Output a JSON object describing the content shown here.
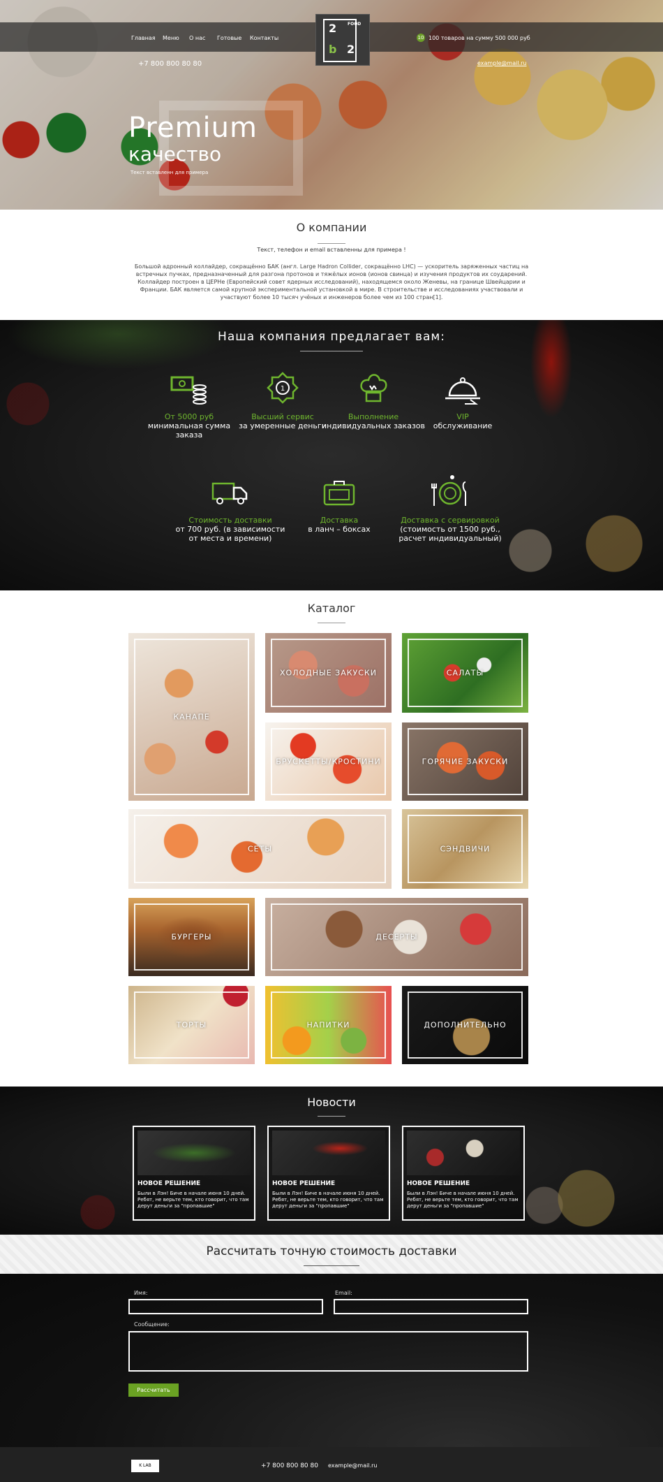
{
  "nav": {
    "items": [
      "Главная",
      "Меню",
      "О нас",
      "Готовые",
      "Контакты"
    ]
  },
  "logo": {
    "tl": "2",
    "tr": "FOOD",
    "br": "2",
    "bl": "b"
  },
  "header": {
    "cart_count": "10",
    "cart_text": "100 товаров на сумму 500 000 руб",
    "phone": "+7 800 800 80 80",
    "email": "example@mail.ru"
  },
  "hero": {
    "title": "Premium",
    "subtitle": "качество",
    "caption": "Текст вставленн для примера"
  },
  "about": {
    "title": "О компании",
    "sub": "Текст, телефон и email вставленны для примера !",
    "body": "Большой адронный коллайдер, сокращённо БАК (англ. Large Hadron Collider, сокращённо LHC) — ускоритель заряженных частиц на встречных пучках, предназначенный для разгона протонов и тяжёлых ионов (ионов свинца) и изучения продуктов их соударений. Коллайдер построен в ЦЕРНе (Европейский совет ядерных исследований), находящемся около Женевы, на границе Швейцарии и Франции. БАК является самой крупной экспериментальной установкой в мире. В строительстве и исследованиях участвовали и участвуют более 10 тысяч учёных и инженеров более чем из 100 стран[1]."
  },
  "offer": {
    "title": "Наша компания предлагает вам:",
    "items": [
      {
        "icon": "money-icon",
        "green": "От 5000 руб",
        "white": "минимальная сумма заказа"
      },
      {
        "icon": "award-medal-icon",
        "green": "Высший сервис",
        "white": "за умеренные деньги"
      },
      {
        "icon": "chef-hat-icon",
        "green": "Выполнение",
        "white": "индивидуальных заказов"
      },
      {
        "icon": "cloche-icon",
        "green": "VIP",
        "white": "обслуживание"
      },
      {
        "icon": "delivery-truck-icon",
        "green": "Стоимость доставки",
        "white": "от 700 руб. (в зависимости от места и времени)"
      },
      {
        "icon": "lunchbox-icon",
        "green": "Доставка",
        "white": "в ланч – боксах"
      },
      {
        "icon": "plate-cutlery-icon",
        "green": "Доставка с сервировкой",
        "white": "(стоимость от 1500 руб., расчет индивидуальный)"
      }
    ]
  },
  "catalog": {
    "title": "Каталог",
    "items": [
      "КАНАПЕ",
      "ХОЛОДНЫЕ ЗАКУСКИ",
      "САЛАТЫ",
      "БРУСКЕТТЫ/КРОСТИНИ",
      "ГОРЯЧИЕ ЗАКУСКИ",
      "СЕТЫ",
      "СЭНДВИЧИ",
      "БУРГЕРЫ",
      "ДЕСЕРТЫ",
      "ТОРТЫ",
      "НАПИТКИ",
      "ДОПОЛНИТЕЛЬНО"
    ]
  },
  "news": {
    "title": "Новости",
    "items": [
      {
        "title": "НОВОЕ РЕШЕНИЕ",
        "text": "Были в Лэн! Биче в начале июня 10 дней. Ребят, не верьте тем, кто говорит, что там дерут деньги за \"пропавшие\""
      },
      {
        "title": "НОВОЕ РЕШЕНИЕ",
        "text": "Были в Лэн! Биче в начале июня 10 дней. Ребят, не верьте тем, кто говорит, что там дерут деньги за \"пропавшие\""
      },
      {
        "title": "НОВОЕ РЕШЕНИЕ",
        "text": "Были в Лэн! Биче в начале июня 10 дней. Ребят, не верьте тем, кто говорит, что там дерут деньги за \"пропавшие\""
      }
    ]
  },
  "calc": {
    "title": "Рассчитать точную стоимость доставки",
    "name_label": "Имя:",
    "email_label": "Email:",
    "message_label": "Сообщение:",
    "button": "Рассчитать"
  },
  "footer": {
    "badge": "K LAB",
    "phone": "+7 800 800 80 80",
    "email": "example@mail.ru"
  },
  "colors": {
    "accent_green": "#6fb62e",
    "button_green": "#6aa223",
    "dark_bg": "#151515"
  }
}
